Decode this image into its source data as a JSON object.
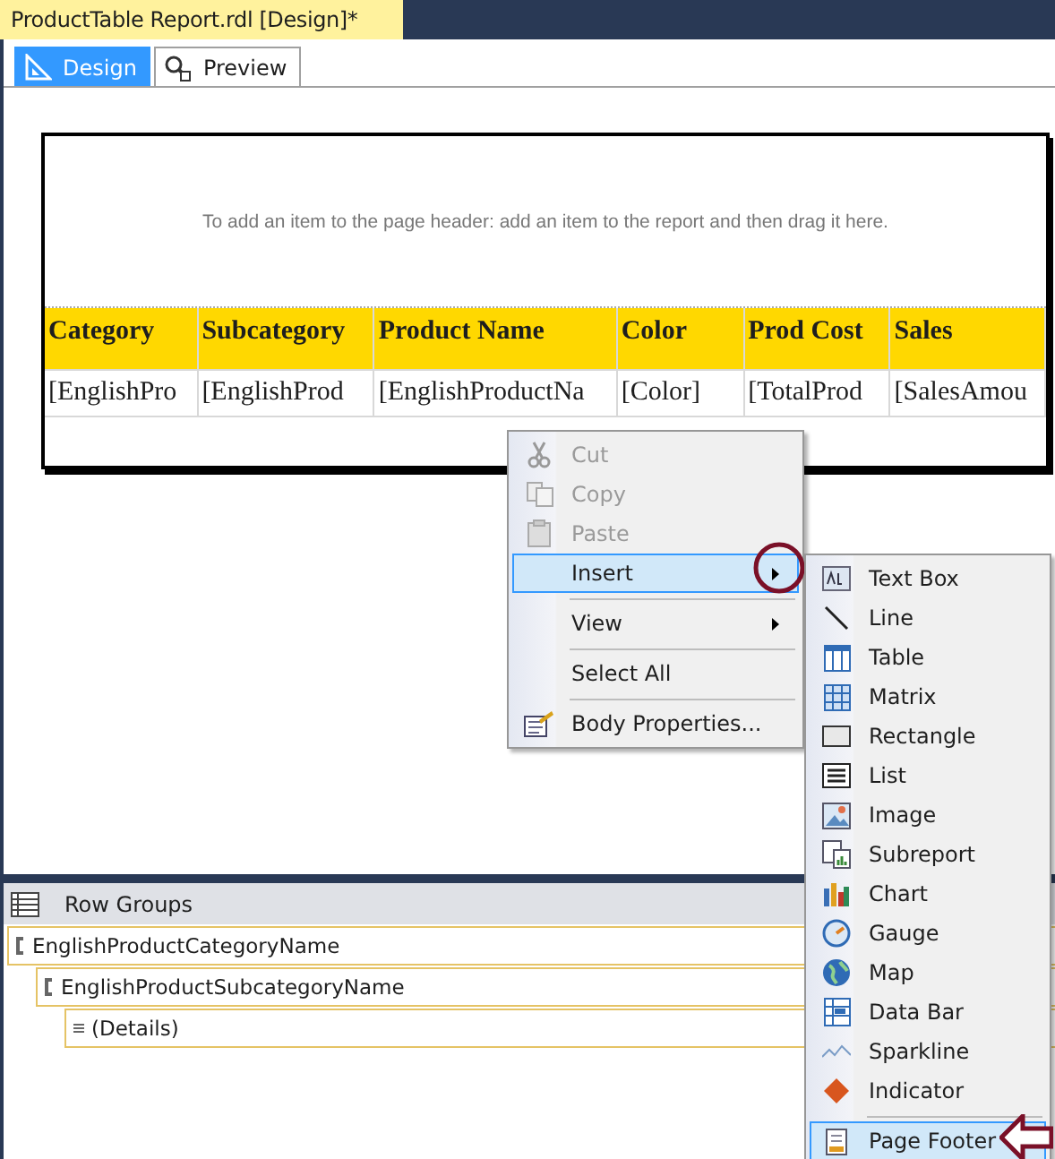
{
  "document_tab": {
    "title": "ProductTable Report.rdl [Design]*"
  },
  "view_tabs": [
    {
      "label": "Design",
      "selected": true
    },
    {
      "label": "Preview",
      "selected": false
    }
  ],
  "report": {
    "header_hint": "To add an item to the page header: add an item to the report and then drag it here.",
    "table": {
      "columns": [
        "Category",
        "Subcategory",
        "Product Name",
        "Color",
        "Prod Cost",
        "Sales"
      ],
      "rows": [
        [
          "[EnglishPro",
          "[EnglishProd",
          "[EnglishProductNa",
          "[Color]",
          "[TotalProd",
          "[SalesAmou"
        ]
      ]
    }
  },
  "context_menu": {
    "items": [
      {
        "kind": "item",
        "label": "Cut",
        "disabled": true,
        "selected": false,
        "submenu": false
      },
      {
        "kind": "item",
        "label": "Copy",
        "disabled": true,
        "selected": false,
        "submenu": false
      },
      {
        "kind": "item",
        "label": "Paste",
        "disabled": true,
        "selected": false,
        "submenu": false
      },
      {
        "kind": "item",
        "label": "Insert",
        "disabled": false,
        "selected": true,
        "submenu": true
      },
      {
        "kind": "separator"
      },
      {
        "kind": "item",
        "label": "View",
        "disabled": false,
        "selected": false,
        "submenu": true
      },
      {
        "kind": "separator"
      },
      {
        "kind": "item",
        "label": "Select All",
        "disabled": false,
        "selected": false,
        "submenu": false
      },
      {
        "kind": "separator"
      },
      {
        "kind": "item",
        "label": "Body Properties...",
        "disabled": false,
        "selected": false,
        "submenu": false
      }
    ]
  },
  "insert_submenu": {
    "items": [
      {
        "kind": "item",
        "label": "Text Box",
        "selected": false
      },
      {
        "kind": "item",
        "label": "Line",
        "selected": false
      },
      {
        "kind": "item",
        "label": "Table",
        "selected": false
      },
      {
        "kind": "item",
        "label": "Matrix",
        "selected": false
      },
      {
        "kind": "item",
        "label": "Rectangle",
        "selected": false
      },
      {
        "kind": "item",
        "label": "List",
        "selected": false
      },
      {
        "kind": "item",
        "label": "Image",
        "selected": false
      },
      {
        "kind": "item",
        "label": "Subreport",
        "selected": false
      },
      {
        "kind": "item",
        "label": "Chart",
        "selected": false
      },
      {
        "kind": "item",
        "label": "Gauge",
        "selected": false
      },
      {
        "kind": "item",
        "label": "Map",
        "selected": false
      },
      {
        "kind": "item",
        "label": "Data Bar",
        "selected": false
      },
      {
        "kind": "item",
        "label": "Sparkline",
        "selected": false
      },
      {
        "kind": "item",
        "label": "Indicator",
        "selected": false
      },
      {
        "kind": "separator"
      },
      {
        "kind": "item",
        "label": "Page Footer",
        "selected": true
      }
    ]
  },
  "row_groups": {
    "title": "Row Groups",
    "groups": [
      {
        "kind": "group",
        "label": "EnglishProductCategoryName",
        "children": [
          {
            "kind": "group",
            "label": "EnglishProductSubcategoryName",
            "children": [
              {
                "kind": "details",
                "label": "(Details)"
              }
            ]
          }
        ]
      }
    ]
  }
}
